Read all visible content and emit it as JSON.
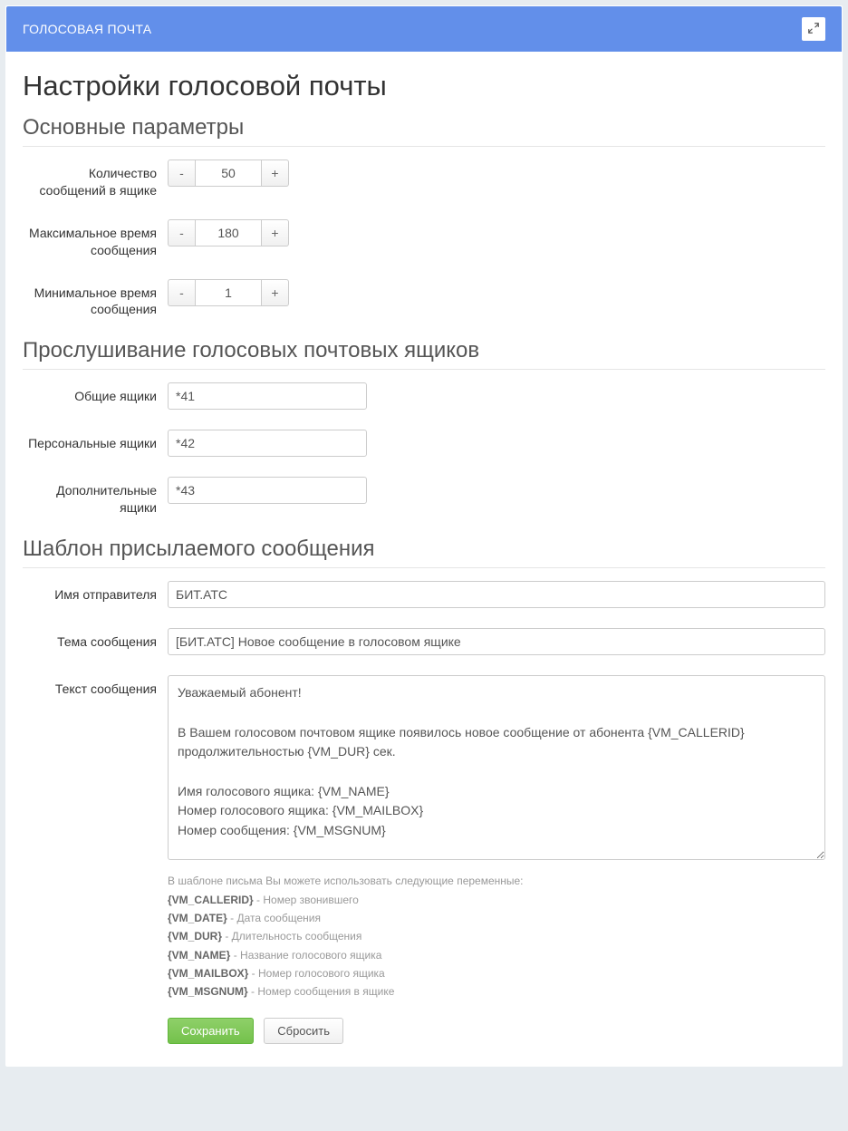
{
  "panel": {
    "title": "ГОЛОСОВАЯ ПОЧТА"
  },
  "page": {
    "heading": "Настройки голосовой почты"
  },
  "sections": {
    "basic": "Основные параметры",
    "listen": "Прослушивание голосовых почтовых ящиков",
    "template": "Шаблон присылаемого сообщения"
  },
  "basic": {
    "maxmsg_label": "Количество сообщений в ящике",
    "maxmsg_value": "50",
    "maxtime_label": "Максимальное время сообщения",
    "maxtime_value": "180",
    "mintime_label": "Минимальное время сообщения",
    "mintime_value": "1"
  },
  "listen": {
    "general_label": "Общие ящики",
    "general_value": "*41",
    "personal_label": "Персональные ящики",
    "personal_value": "*42",
    "extra_label": "Дополнительные ящики",
    "extra_value": "*43"
  },
  "template": {
    "sender_label": "Имя отправителя",
    "sender_value": "БИТ.АТС",
    "subject_label": "Тема сообщения",
    "subject_value": "[БИТ.АТС] Новое сообщение в голосовом ящике",
    "body_label": "Текст сообщения",
    "body_value": "Уважаемый абонент!\n\nВ Вашем голосовом почтовом ящике появилось новое сообщение от абонента {VM_CALLERID} продолжительностью {VM_DUR} сек.\n\nИмя голосового ящика: {VM_NAME}\nНомер голосового ящика: {VM_MAILBOX}\nНомер сообщения: {VM_MSGNUM}"
  },
  "help": {
    "intro": "В шаблоне письма Вы можете использовать следующие переменные:",
    "vars": [
      {
        "name": "{VM_CALLERID}",
        "desc": " - Номер звонившего"
      },
      {
        "name": "{VM_DATE}",
        "desc": " - Дата сообщения"
      },
      {
        "name": "{VM_DUR}",
        "desc": " - Длительность сообщения"
      },
      {
        "name": "{VM_NAME}",
        "desc": " - Название голосового ящика"
      },
      {
        "name": "{VM_MAILBOX}",
        "desc": " - Номер голосового ящика"
      },
      {
        "name": "{VM_MSGNUM}",
        "desc": " - Номер сообщения в ящике"
      }
    ]
  },
  "buttons": {
    "save": "Сохранить",
    "reset": "Сбросить"
  },
  "glyphs": {
    "minus": "-",
    "plus": "+"
  }
}
